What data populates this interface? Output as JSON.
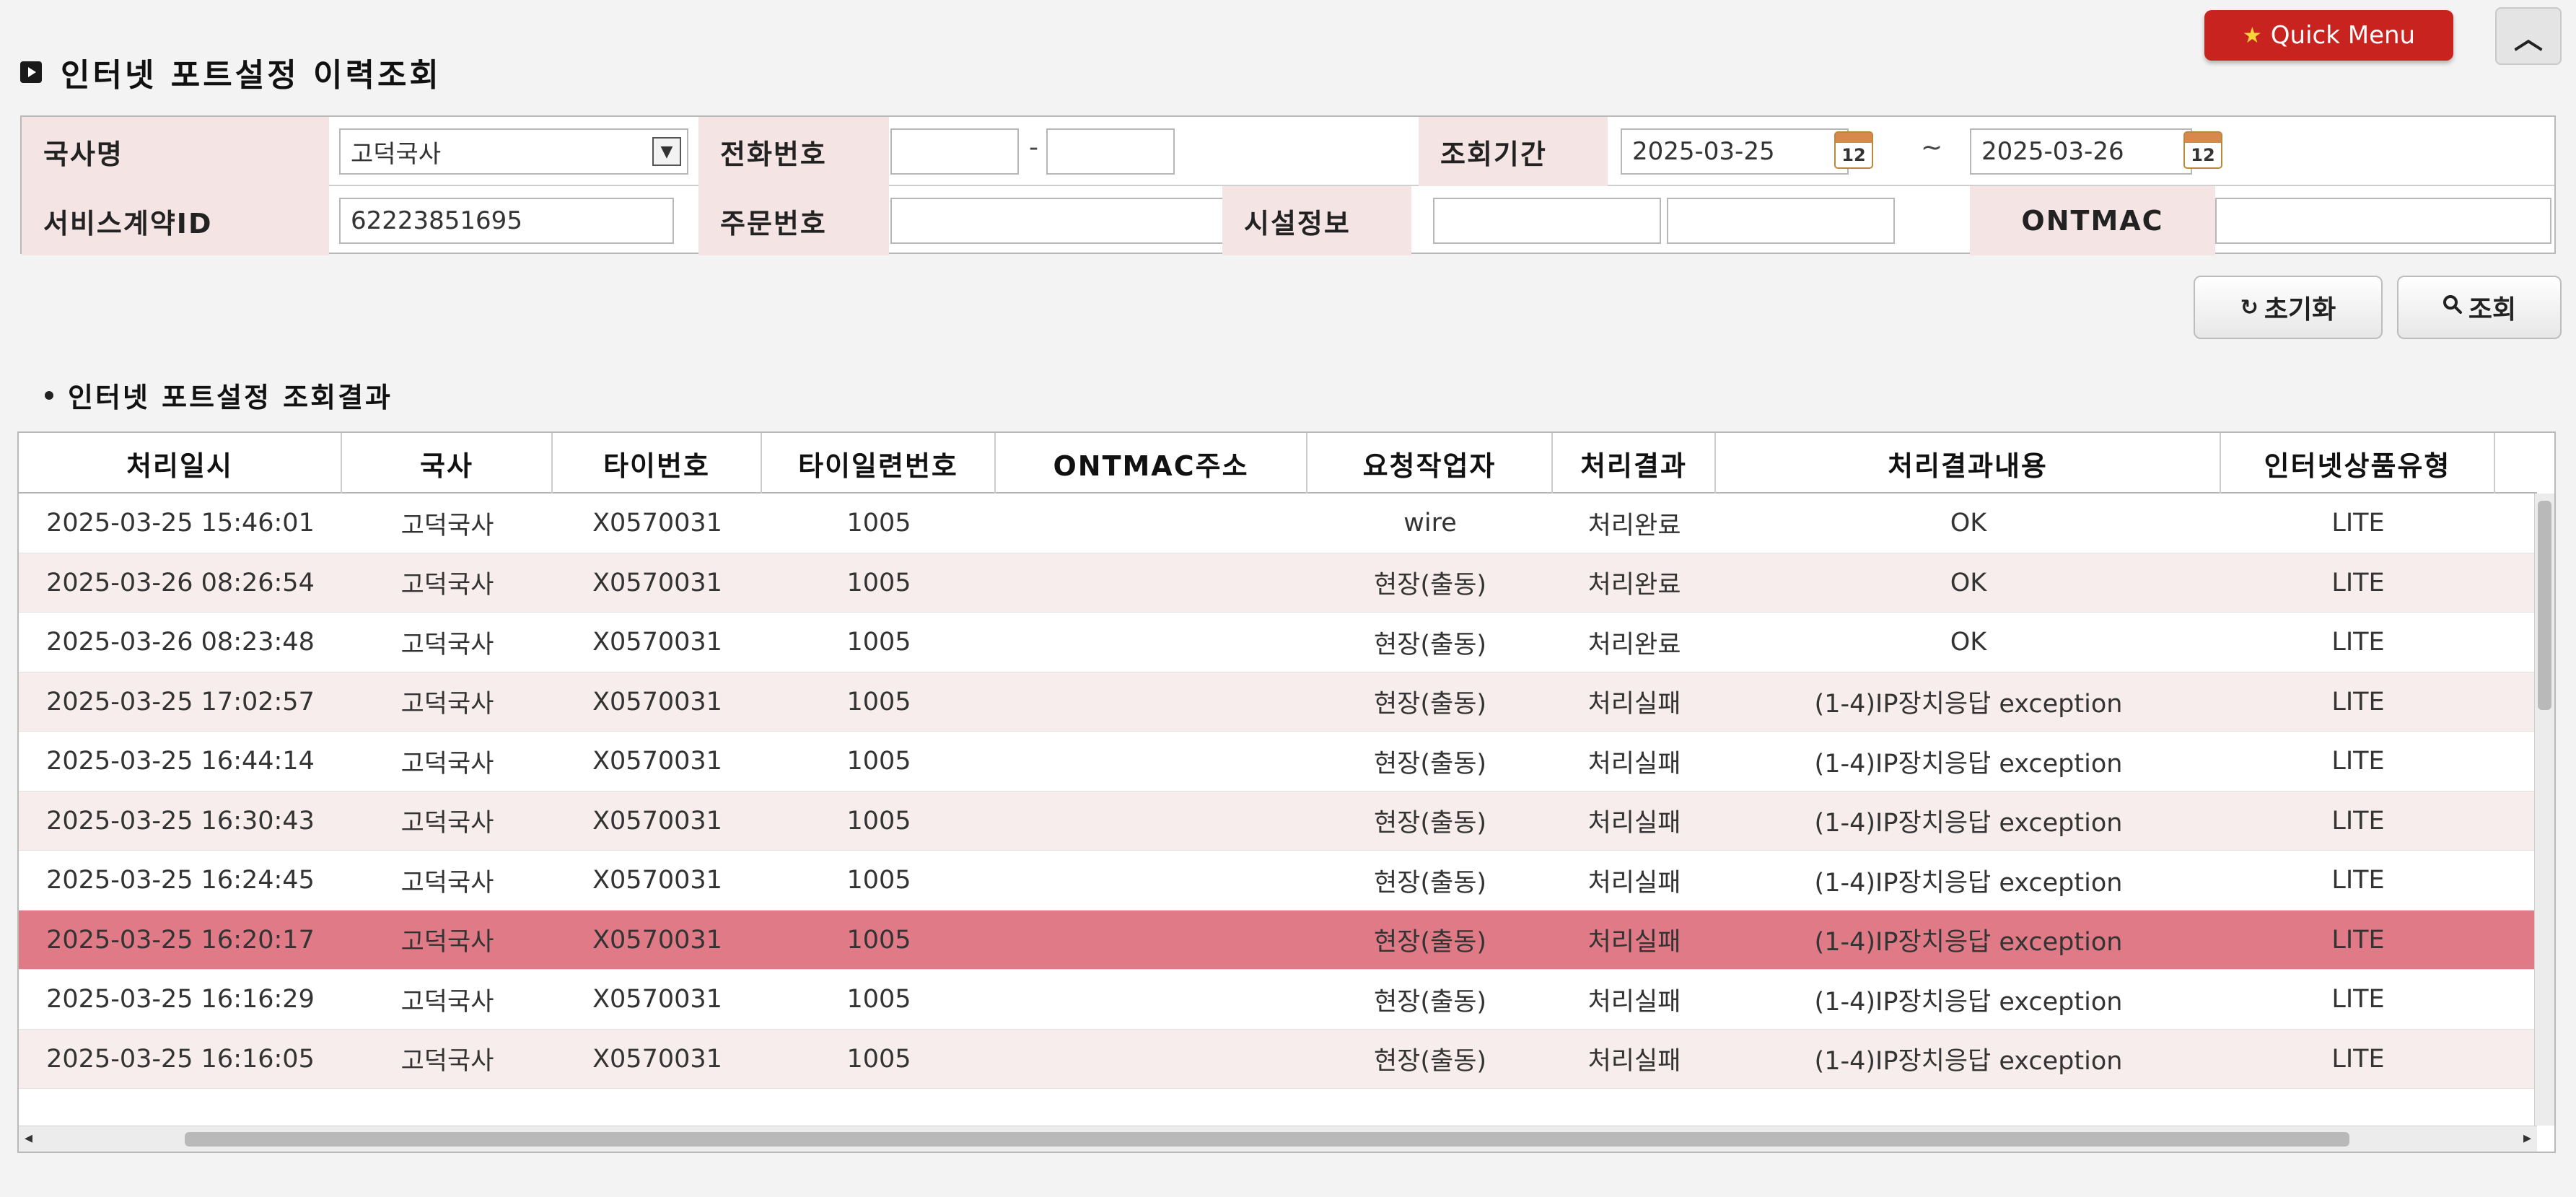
{
  "header": {
    "title": "인터넷 포트설정 이력조회",
    "quick_menu_label": "Quick Menu",
    "collapse_symbol": "︿"
  },
  "form": {
    "office_label": "국사명",
    "office_value": "고덕국사",
    "phone_label": "전화번호",
    "phone_part1": "",
    "phone_part2": "",
    "phone_dash": "-",
    "period_label": "조회기간",
    "period_from": "2025-03-25",
    "period_tilde": "~",
    "period_to": "2025-03-26",
    "calendar_day": "12",
    "contract_label": "서비스계약ID",
    "contract_value": "62223851695",
    "order_label": "주문번호",
    "order_value": "",
    "facility_label": "시설정보",
    "facility_value1": "",
    "facility_value2": "",
    "ontmac_label": "ONTMAC",
    "ontmac_value": ""
  },
  "buttons": {
    "reset_label": "초기화",
    "search_label": "조회"
  },
  "results": {
    "title": "인터넷 포트설정 조회결과",
    "columns": [
      "처리일시",
      "국사",
      "타이번호",
      "타이일련번호",
      "ONTMAC주소",
      "요청작업자",
      "처리결과",
      "처리결과내용",
      "인터넷상품유형"
    ],
    "rows": [
      {
        "datetime": "2025-03-25 15:46:01",
        "office": "고덕국사",
        "tie_no": "X0570031",
        "tie_serial": "1005",
        "ontmac": "",
        "requester": "wire",
        "result": "처리완료",
        "detail": "OK",
        "product": "LITE"
      },
      {
        "datetime": "2025-03-26 08:26:54",
        "office": "고덕국사",
        "tie_no": "X0570031",
        "tie_serial": "1005",
        "ontmac": "",
        "requester": "현장(출동)",
        "result": "처리완료",
        "detail": "OK",
        "product": "LITE"
      },
      {
        "datetime": "2025-03-26 08:23:48",
        "office": "고덕국사",
        "tie_no": "X0570031",
        "tie_serial": "1005",
        "ontmac": "",
        "requester": "현장(출동)",
        "result": "처리완료",
        "detail": "OK",
        "product": "LITE"
      },
      {
        "datetime": "2025-03-25 17:02:57",
        "office": "고덕국사",
        "tie_no": "X0570031",
        "tie_serial": "1005",
        "ontmac": "",
        "requester": "현장(출동)",
        "result": "처리실패",
        "detail": "(1-4)IP장치응답 exception",
        "product": "LITE"
      },
      {
        "datetime": "2025-03-25 16:44:14",
        "office": "고덕국사",
        "tie_no": "X0570031",
        "tie_serial": "1005",
        "ontmac": "",
        "requester": "현장(출동)",
        "result": "처리실패",
        "detail": "(1-4)IP장치응답 exception",
        "product": "LITE"
      },
      {
        "datetime": "2025-03-25 16:30:43",
        "office": "고덕국사",
        "tie_no": "X0570031",
        "tie_serial": "1005",
        "ontmac": "",
        "requester": "현장(출동)",
        "result": "처리실패",
        "detail": "(1-4)IP장치응답 exception",
        "product": "LITE"
      },
      {
        "datetime": "2025-03-25 16:24:45",
        "office": "고덕국사",
        "tie_no": "X0570031",
        "tie_serial": "1005",
        "ontmac": "",
        "requester": "현장(출동)",
        "result": "처리실패",
        "detail": "(1-4)IP장치응답 exception",
        "product": "LITE"
      },
      {
        "datetime": "2025-03-25 16:20:17",
        "office": "고덕국사",
        "tie_no": "X0570031",
        "tie_serial": "1005",
        "ontmac": "",
        "requester": "현장(출동)",
        "result": "처리실패",
        "detail": "(1-4)IP장치응답 exception",
        "product": "LITE"
      },
      {
        "datetime": "2025-03-25 16:16:29",
        "office": "고덕국사",
        "tie_no": "X0570031",
        "tie_serial": "1005",
        "ontmac": "",
        "requester": "현장(출동)",
        "result": "처리실패",
        "detail": "(1-4)IP장치응답 exception",
        "product": "LITE"
      },
      {
        "datetime": "2025-03-25 16:16:05",
        "office": "고덕국사",
        "tie_no": "X0570031",
        "tie_serial": "1005",
        "ontmac": "",
        "requester": "현장(출동)",
        "result": "처리실패",
        "detail": "(1-4)IP장치응답 exception",
        "product": "LITE"
      }
    ]
  },
  "icons": {
    "title": "title-square-icon",
    "quick_menu": "star-icon",
    "select": "dropdown-arrow-icon",
    "calendar": "calendar-icon",
    "reset": "refresh-icon",
    "search": "search-icon"
  },
  "colors": {
    "quick_menu": "#c8231f",
    "label_bg": "#f4e4e4",
    "alt_row": "#f8eded",
    "selected_row": "#df7a86"
  }
}
